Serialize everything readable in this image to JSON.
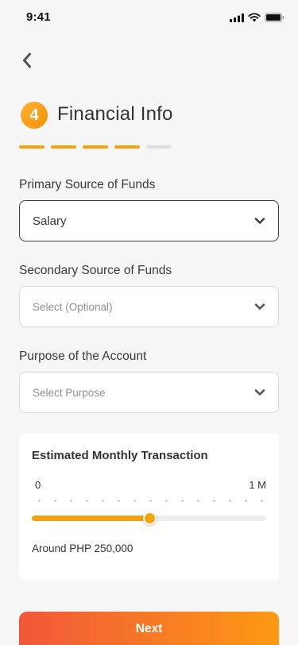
{
  "status_bar": {
    "time": "9:41"
  },
  "header": {
    "step_number": "4",
    "title": "Financial Info"
  },
  "progress": {
    "completed": 4,
    "total": 5
  },
  "fields": {
    "primary": {
      "label": "Primary Source of Funds",
      "value": "Salary"
    },
    "secondary": {
      "label": "Secondary Source of Funds",
      "placeholder": "Select (Optional)"
    },
    "purpose": {
      "label": "Purpose of the Account",
      "placeholder": "Select Purpose"
    }
  },
  "transaction": {
    "title": "Estimated Monthly Transaction",
    "min_label": "0",
    "max_label": "1 M",
    "slider_fraction": 0.5,
    "estimate_text": "Around PHP 250,000"
  },
  "actions": {
    "next_label": "Next"
  },
  "colors": {
    "accent": "#f5a20f",
    "button_start": "#f0573a",
    "button_end": "#fd9a13"
  }
}
